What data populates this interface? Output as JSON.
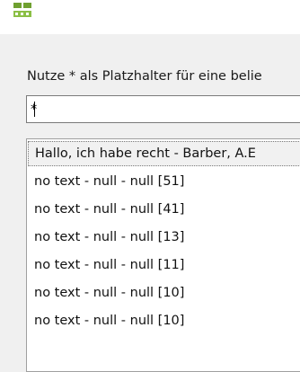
{
  "search": {
    "hint": "Nutze * als Platzhalter für eine belie",
    "value": "*"
  },
  "results": {
    "items": [
      {
        "label": "Hallo, ich habe recht - Barber, A.E"
      },
      {
        "label": "no text - null - null [51]"
      },
      {
        "label": "no text - null - null [41]"
      },
      {
        "label": "no text - null - null [13]"
      },
      {
        "label": "no text - null - null [11]"
      },
      {
        "label": "no text - null - null [10]"
      },
      {
        "label": "no text - null - null [10]"
      }
    ],
    "selected_index": 0
  },
  "colors": {
    "app_icon": "#6fa030",
    "window_bg": "#f0f0f0",
    "titlebar_bg": "#ffffff"
  },
  "icons": {
    "app": "application-logo-icon"
  }
}
